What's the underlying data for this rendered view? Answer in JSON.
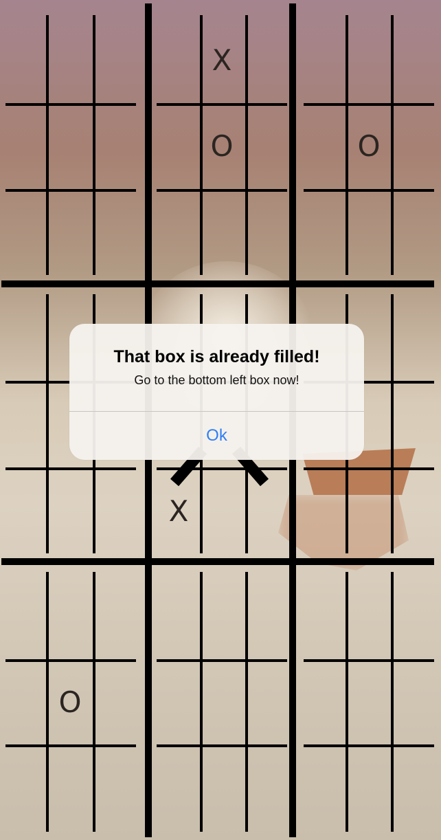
{
  "board": {
    "marks": [
      {
        "id": "mark-x-top-middle",
        "text": "X"
      },
      {
        "id": "mark-o-top-middle",
        "text": "O"
      },
      {
        "id": "mark-o-top-right",
        "text": "O"
      },
      {
        "id": "mark-x-center",
        "text": "X"
      },
      {
        "id": "mark-o-bottom-left",
        "text": "O"
      }
    ]
  },
  "alert": {
    "title": "That box is already filled!",
    "message": "Go to the bottom left box now!",
    "button_label": "Ok"
  },
  "colors": {
    "grid": "#000000",
    "mark": "#2b2521",
    "alert_button": "#2f7ef5"
  }
}
